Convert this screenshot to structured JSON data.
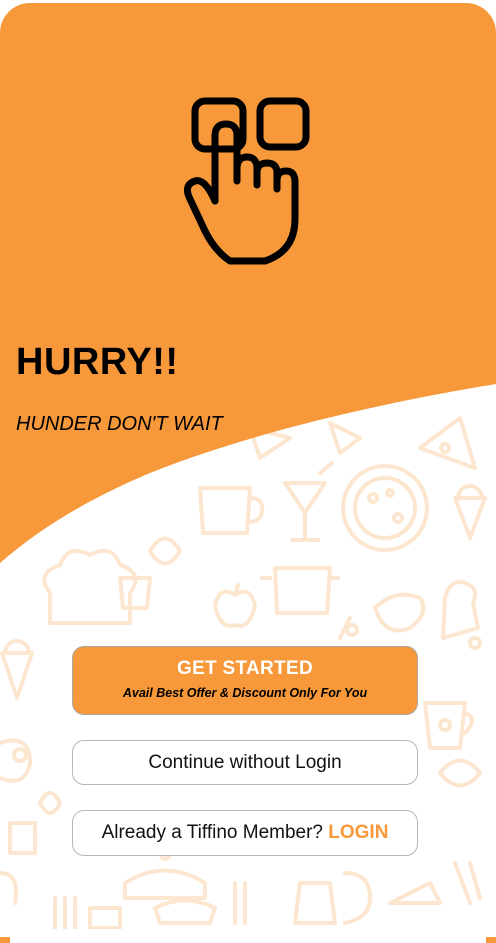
{
  "colors": {
    "brand": "#f7993a",
    "doodle": "#fde6cf",
    "text": "#000000",
    "button_border": "#b7b7b7"
  },
  "hero": {
    "icon": "tap-hand-icon",
    "headline": "HURRY!!",
    "tagline": "HUNDER DON'T WAIT"
  },
  "actions": {
    "get_started": {
      "label": "GET STARTED",
      "sublabel": "Avail Best Offer & Discount Only For You"
    },
    "continue_without_login": {
      "label": "Continue without Login"
    },
    "member_login": {
      "prompt": "Already a Tiffino Member?",
      "link": "LOGIN"
    }
  },
  "background": {
    "pattern": "food-doodle-pattern"
  }
}
